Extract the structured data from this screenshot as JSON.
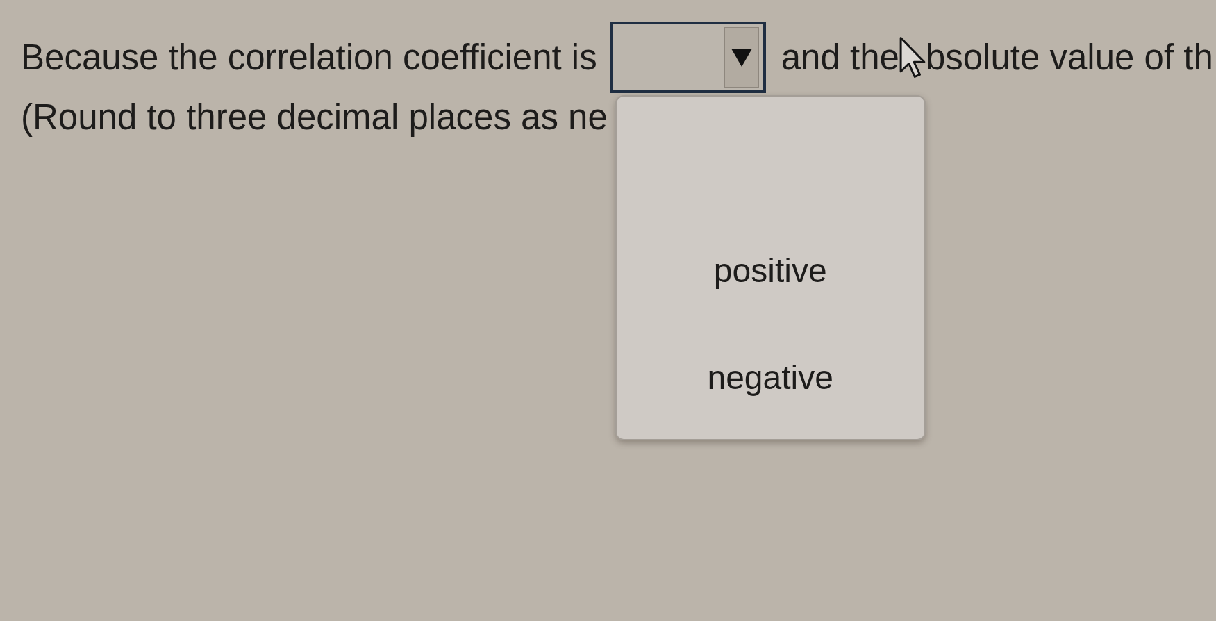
{
  "question": {
    "segments": [
      {
        "kind": "text",
        "text": "Because the correlation coefficient is"
      },
      {
        "kind": "dropdown",
        "expanded": true,
        "options": [
          {
            "label": "positive",
            "selected": false
          },
          {
            "label": "negative",
            "selected": false
          }
        ]
      },
      {
        "kind": "text",
        "text": "and the"
      },
      {
        "kind": "pointer"
      },
      {
        "kind": "text",
        "text": "bsolute value of th"
      }
    ],
    "note": "(Round to three decimal places as ne"
  }
}
